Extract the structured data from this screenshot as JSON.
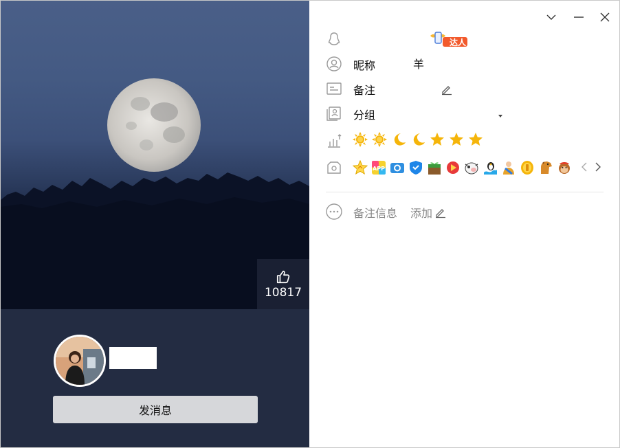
{
  "left_panel": {
    "like_count": "10817",
    "send_button_label": "发消息"
  },
  "profile": {
    "nickname_label": "昵称",
    "nickname_value": "羊",
    "remark_label": "备注",
    "group_label": "分组",
    "remark_info_label": "备注信息",
    "add_label": "添加",
    "talent_badge_text": "达人"
  },
  "level_icons": [
    "sun-icon",
    "sun-icon",
    "moon-icon",
    "moon-icon",
    "star-icon",
    "star-icon",
    "star-icon"
  ],
  "badge_icons": [
    "badge-star",
    "badge-app",
    "badge-camera",
    "badge-shield",
    "badge-plant",
    "badge-game",
    "badge-cow",
    "badge-penguin-wave",
    "badge-person",
    "badge-coin",
    "badge-horse",
    "badge-monkey"
  ],
  "colors": {
    "left_bg": "#232c42",
    "send_button_bg": "#d6d7da",
    "gold": "#f5b50a"
  }
}
